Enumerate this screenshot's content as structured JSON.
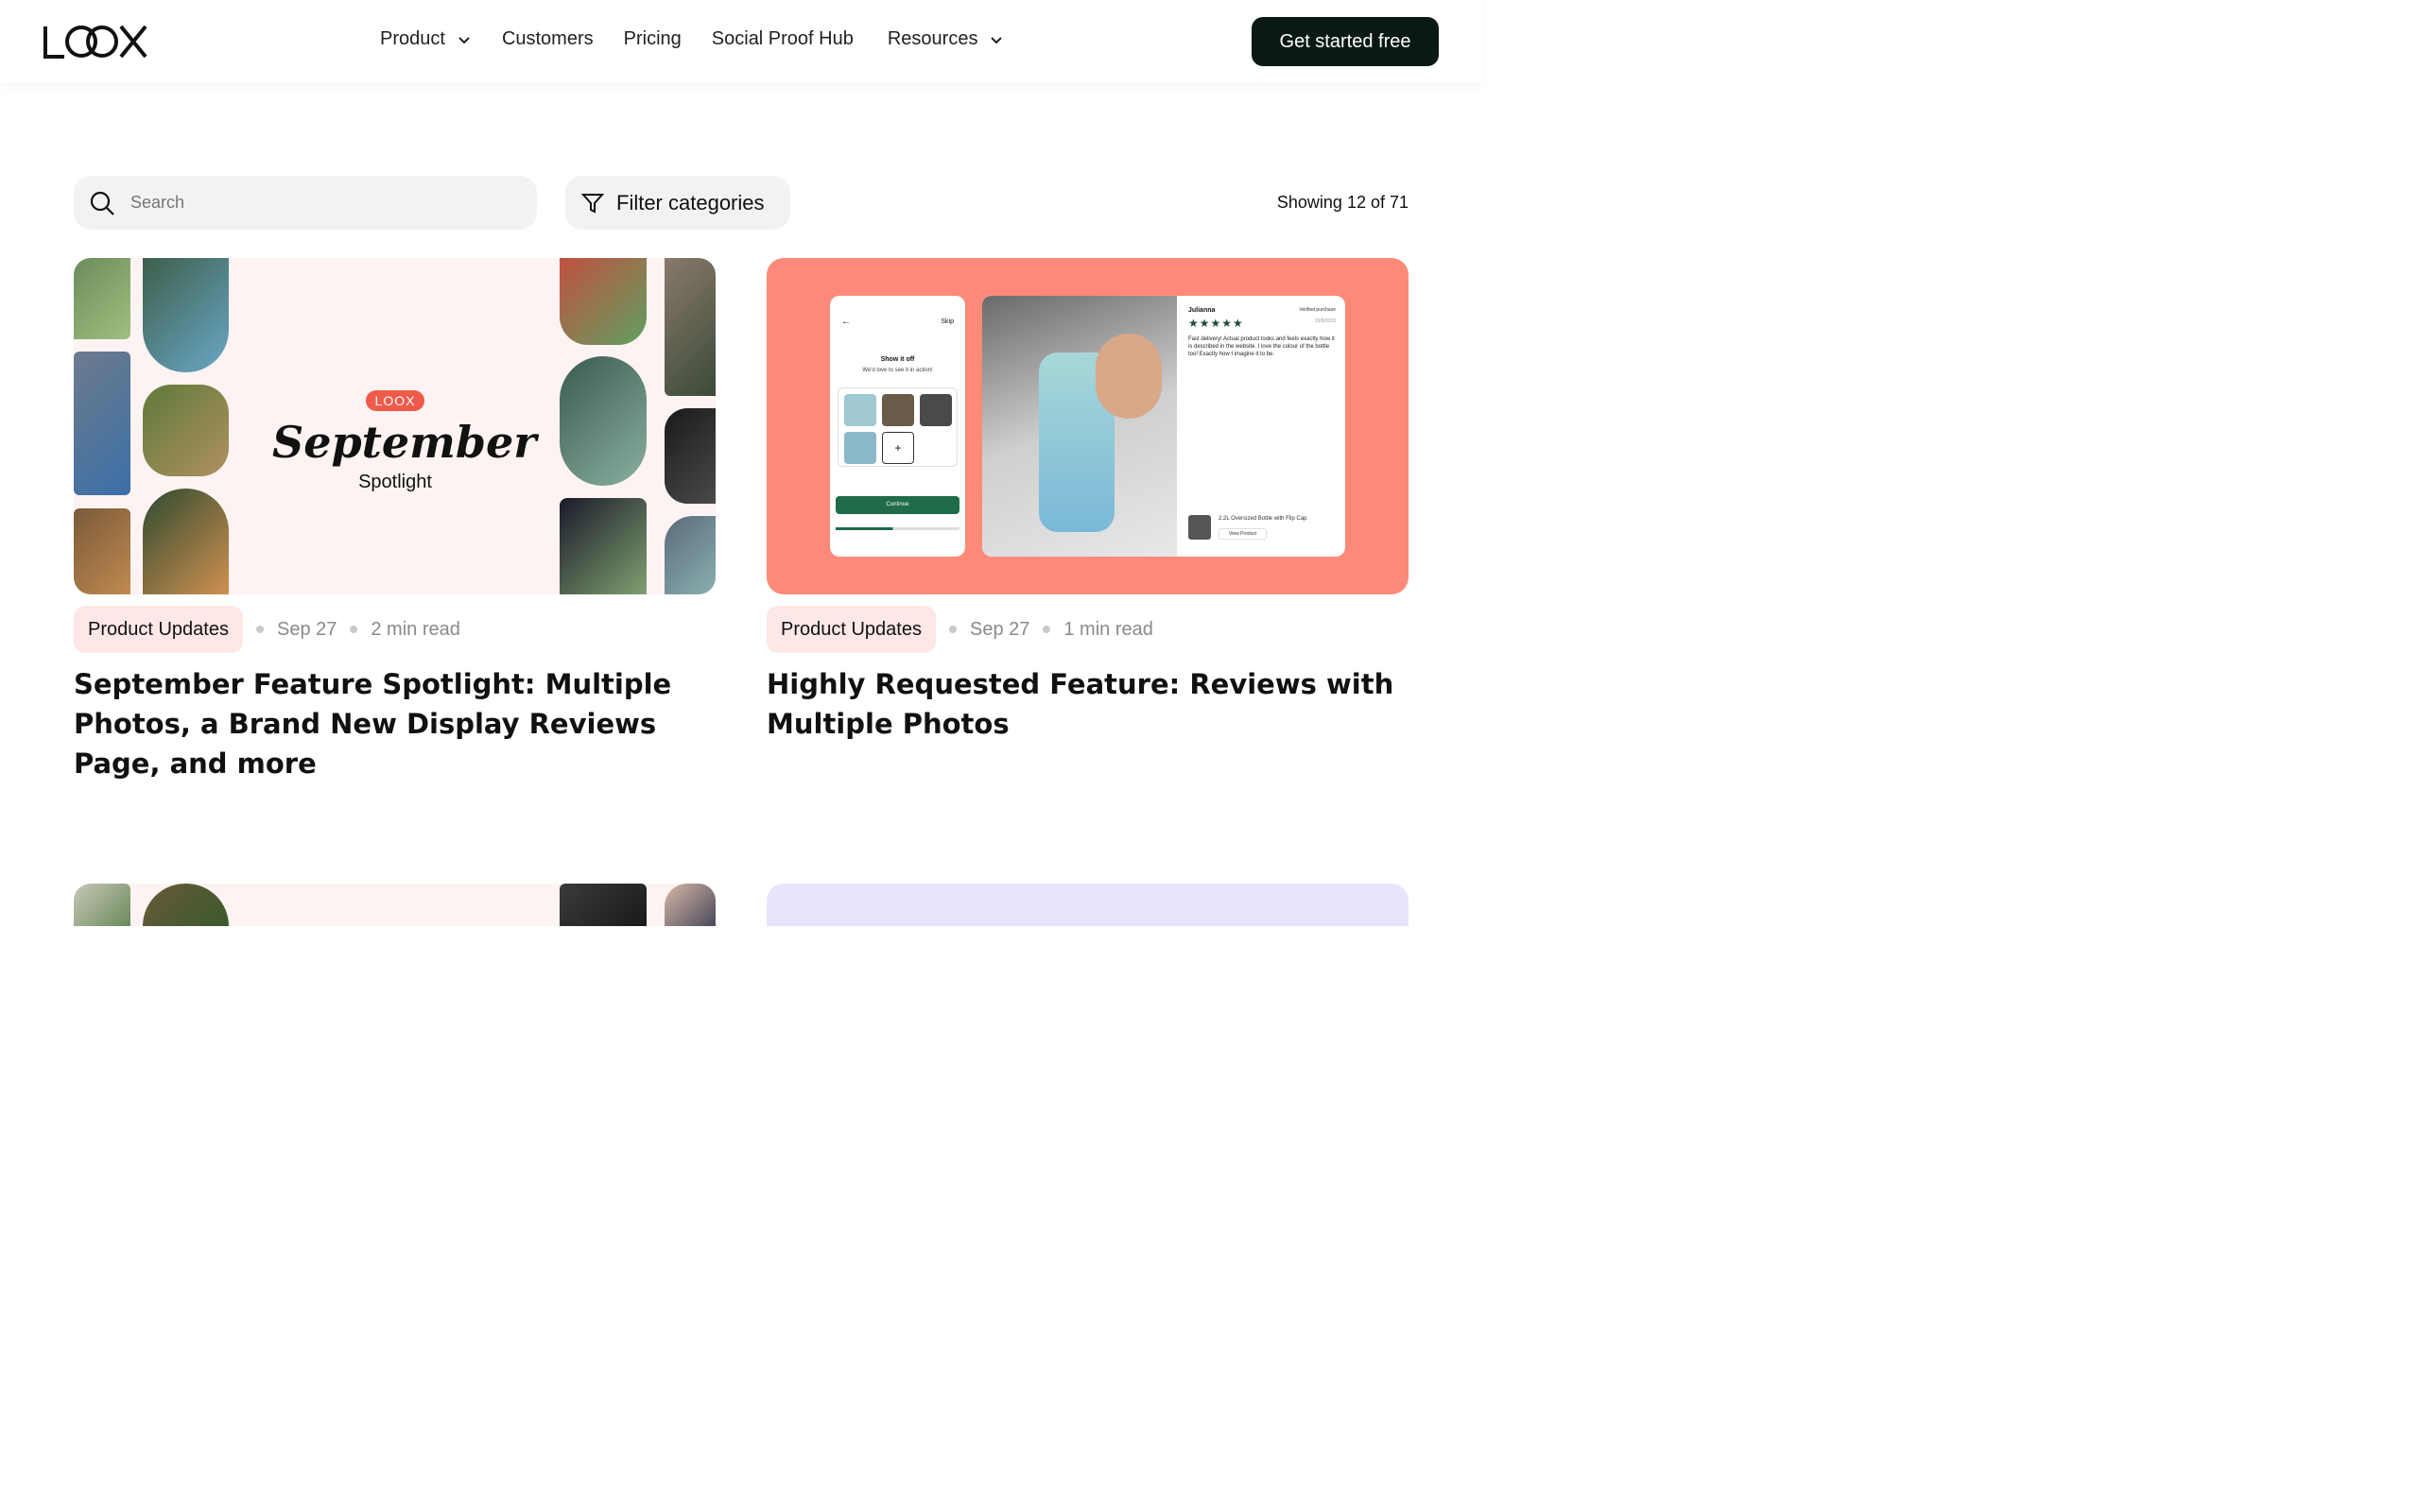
{
  "header": {
    "logo": "LOOX",
    "nav": [
      {
        "label": "Product",
        "dropdown": true
      },
      {
        "label": "Customers",
        "dropdown": false
      },
      {
        "label": "Pricing",
        "dropdown": false
      },
      {
        "label": "Social Proof Hub",
        "dropdown": false
      },
      {
        "label": "Resources",
        "dropdown": true
      }
    ],
    "cta": "Get started free"
  },
  "toolbar": {
    "search_placeholder": "Search",
    "filter_label": "Filter categories",
    "showing": "Showing 12 of 71"
  },
  "cards": [
    {
      "image": {
        "badge": "LOOX",
        "headline": "September",
        "subhead": "Spotlight"
      },
      "tag": "Product Updates",
      "date": "Sep 27",
      "read": "2 min read",
      "title": "September Feature Spotlight: Multiple Photos, a Brand New Display Reviews Page, and more"
    },
    {
      "image": {
        "phone_skip": "Skip",
        "phone_title": "Show it off",
        "phone_sub": "We'd love to see it in action!",
        "phone_button": "Continue",
        "review_name": "Julianna",
        "review_verified": "Verified purchase",
        "review_date": "15/8/2023",
        "review_text": "Fast delivery! Actual product looks and feels exactly how it is described in the website. I love the colour of the bottle too! Exactly how I imagine it to be.",
        "product_name": "2.2L Oversized Bottle with Flip Cap",
        "view_product": "View Product"
      },
      "tag": "Product Updates",
      "date": "Sep 27",
      "read": "1 min read",
      "title": "Highly Requested Feature: Reviews with Multiple Photos"
    }
  ],
  "colors": {
    "cta_bg": "#0a1a13",
    "tag_bg": "#fde7e7",
    "card2_bg": "#fd8a78",
    "card1_bg": "#fdf3f2",
    "card4_bg": "#e8e4fb"
  }
}
